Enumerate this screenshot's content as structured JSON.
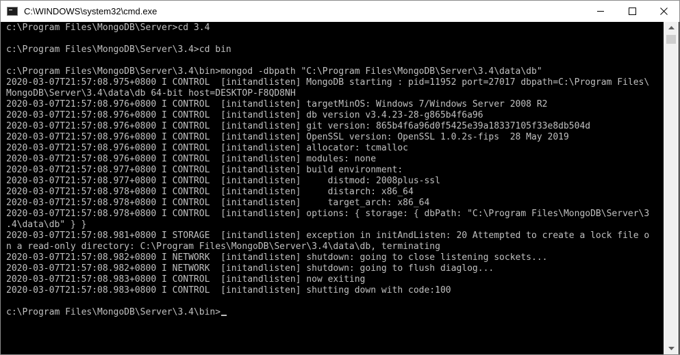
{
  "window": {
    "title": "C:\\WINDOWS\\system32\\cmd.exe",
    "icon": "console-app-icon",
    "controls": [
      "minimize-icon",
      "maximize-icon",
      "close-icon"
    ]
  },
  "console": {
    "text_color": "#c0c0c0",
    "background": "#000000",
    "lines": [
      "c:\\Program Files\\MongoDB\\Server>cd 3.4",
      "",
      "c:\\Program Files\\MongoDB\\Server\\3.4>cd bin",
      "",
      "c:\\Program Files\\MongoDB\\Server\\3.4\\bin>mongod -dbpath \"C:\\Program Files\\MongoDB\\Server\\3.4\\data\\db\"",
      "2020-03-07T21:57:08.975+0800 I CONTROL  [initandlisten] MongoDB starting : pid=11952 port=27017 dbpath=C:\\Program Files\\",
      "MongoDB\\Server\\3.4\\data\\db 64-bit host=DESKTOP-F8QD8NH",
      "2020-03-07T21:57:08.976+0800 I CONTROL  [initandlisten] targetMinOS: Windows 7/Windows Server 2008 R2",
      "2020-03-07T21:57:08.976+0800 I CONTROL  [initandlisten] db version v3.4.23-28-g865b4f6a96",
      "2020-03-07T21:57:08.976+0800 I CONTROL  [initandlisten] git version: 865b4f6a96d0f5425e39a18337105f33e8db504d",
      "2020-03-07T21:57:08.976+0800 I CONTROL  [initandlisten] OpenSSL version: OpenSSL 1.0.2s-fips  28 May 2019",
      "2020-03-07T21:57:08.976+0800 I CONTROL  [initandlisten] allocator: tcmalloc",
      "2020-03-07T21:57:08.976+0800 I CONTROL  [initandlisten] modules: none",
      "2020-03-07T21:57:08.977+0800 I CONTROL  [initandlisten] build environment:",
      "2020-03-07T21:57:08.977+0800 I CONTROL  [initandlisten]     distmod: 2008plus-ssl",
      "2020-03-07T21:57:08.978+0800 I CONTROL  [initandlisten]     distarch: x86_64",
      "2020-03-07T21:57:08.978+0800 I CONTROL  [initandlisten]     target_arch: x86_64",
      "2020-03-07T21:57:08.978+0800 I CONTROL  [initandlisten] options: { storage: { dbPath: \"C:\\Program Files\\MongoDB\\Server\\3",
      ".4\\data\\db\" } }",
      "2020-03-07T21:57:08.981+0800 I STORAGE  [initandlisten] exception in initAndListen: 20 Attempted to create a lock file o",
      "n a read-only directory: C:\\Program Files\\MongoDB\\Server\\3.4\\data\\db, terminating",
      "2020-03-07T21:57:08.982+0800 I NETWORK  [initandlisten] shutdown: going to close listening sockets...",
      "2020-03-07T21:57:08.982+0800 I NETWORK  [initandlisten] shutdown: going to flush diaglog...",
      "2020-03-07T21:57:08.983+0800 I CONTROL  [initandlisten] now exiting",
      "2020-03-07T21:57:08.983+0800 I CONTROL  [initandlisten] shutting down with code:100",
      "",
      "c:\\Program Files\\MongoDB\\Server\\3.4\\bin>"
    ]
  },
  "scrollbar": {
    "up_icon": "scroll-up-arrow-icon",
    "down_icon": "scroll-down-arrow-icon"
  }
}
